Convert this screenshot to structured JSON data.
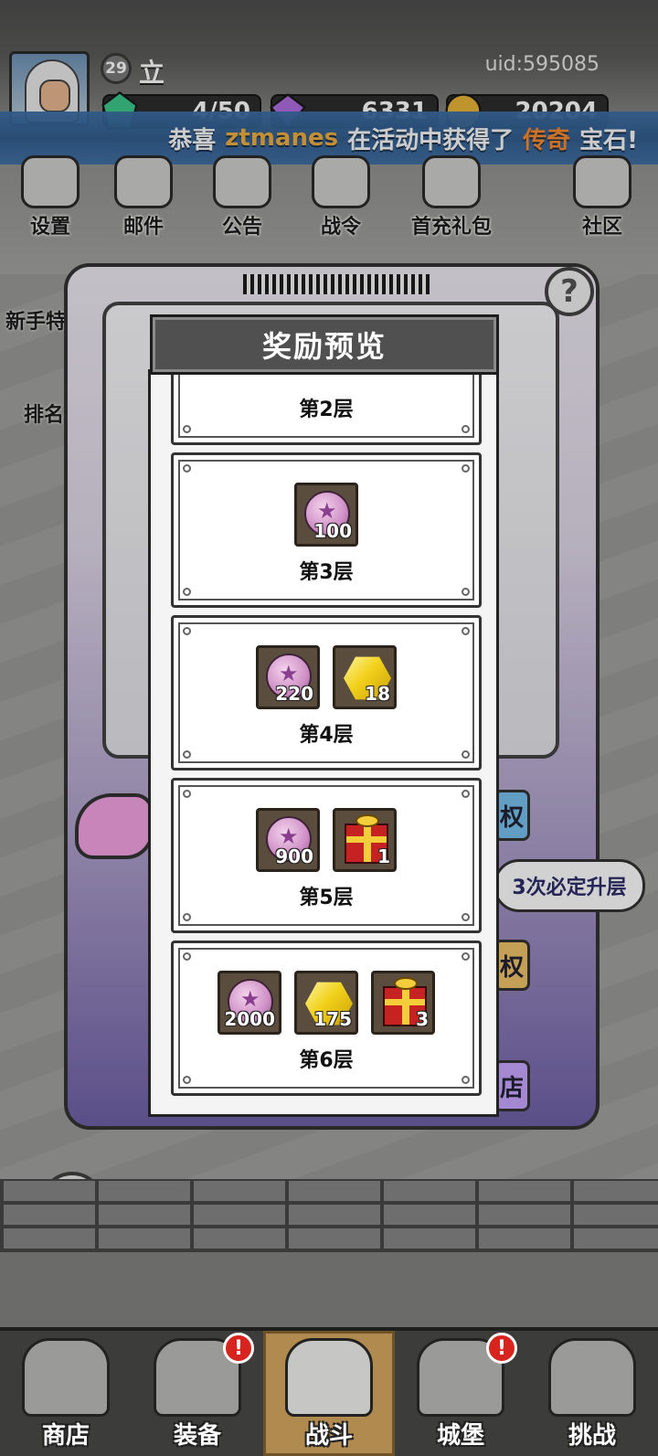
{
  "player": {
    "level": "29",
    "name": "立",
    "uid": "uid:595085",
    "energy": "4/50",
    "diamonds": "6331",
    "gold": "20204"
  },
  "broadcast": {
    "prefix": "恭喜",
    "player": "ztmanes",
    "middle": "在活动中获得了",
    "rarity": "传奇",
    "suffix": "宝石!"
  },
  "top_menu": [
    {
      "label": "设置",
      "icon": "gear-icon"
    },
    {
      "label": "邮件",
      "icon": "mail-icon"
    },
    {
      "label": "公告",
      "icon": "scroll-icon"
    },
    {
      "label": "战令",
      "icon": "battle-pass-icon"
    },
    {
      "label": "首充礼包",
      "icon": "gift-bag-icon"
    },
    {
      "label": "社区",
      "icon": "home-icon"
    }
  ],
  "side_menu": [
    {
      "label": "新手特",
      "icon": "bag-icon"
    },
    {
      "label": "排名",
      "icon": "ranking-icon"
    }
  ],
  "background": {
    "hint_bubble": "3次必定升层",
    "side_btn_1": "权",
    "side_btn_2": "权",
    "side_btn_3": "店"
  },
  "dialog": {
    "title": "奖励预览",
    "layers": [
      {
        "name": "第2层",
        "items": []
      },
      {
        "name": "第3层",
        "items": [
          {
            "type": "coin",
            "qty": "100"
          }
        ]
      },
      {
        "name": "第4层",
        "items": [
          {
            "type": "coin",
            "qty": "220"
          },
          {
            "type": "gem",
            "qty": "18"
          }
        ]
      },
      {
        "name": "第5层",
        "items": [
          {
            "type": "coin",
            "qty": "900"
          },
          {
            "type": "gift",
            "qty": "1"
          }
        ]
      },
      {
        "name": "第6层",
        "items": [
          {
            "type": "coin",
            "qty": "2000"
          },
          {
            "type": "gem",
            "qty": "175"
          },
          {
            "type": "gift",
            "qty": "3"
          }
        ]
      }
    ]
  },
  "bottom_nav": [
    {
      "label": "商店",
      "icon": "shop-icon",
      "badge": false,
      "active": false
    },
    {
      "label": "装备",
      "icon": "backpack-icon",
      "badge": true,
      "active": false
    },
    {
      "label": "战斗",
      "icon": "crossed-swords-icon",
      "badge": false,
      "active": true
    },
    {
      "label": "城堡",
      "icon": "castle-icon",
      "badge": true,
      "active": false
    },
    {
      "label": "挑战",
      "icon": "shield-icon",
      "badge": false,
      "active": false
    }
  ],
  "badge_text": "!",
  "colors": {
    "broadcast_bg": "#2f5c8f",
    "player_highlight": "#f4b13d",
    "rarity_highlight": "#ff8a2a",
    "nav_active": "#b08a4e"
  }
}
